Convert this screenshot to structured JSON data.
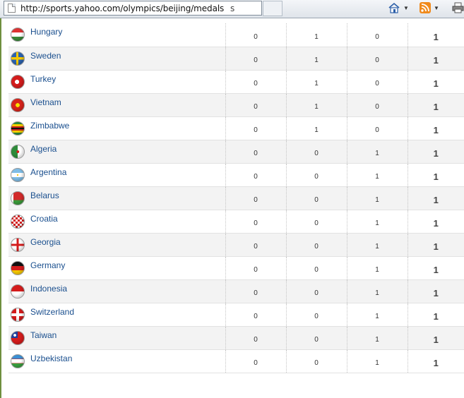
{
  "browser": {
    "url": "http://sports.yahoo.com/olympics/beijing/medals",
    "url_trailing": "s",
    "home_icon": "home-icon",
    "feeds_icon": "rss-feed-icon",
    "print_icon": "printer-icon"
  },
  "rows": [
    {
      "country": "Hungary",
      "gold": "0",
      "silver": "1",
      "bronze": "0",
      "total": "1",
      "flag": "linear-gradient(#d33 0 33%, #fff 33% 66%, #3a8a3a 66%)"
    },
    {
      "country": "Sweden",
      "gold": "0",
      "silver": "1",
      "bronze": "0",
      "total": "1",
      "flag": "linear-gradient(90deg, transparent 38%, #f6c900 38% 55%, transparent 55%), linear-gradient(transparent 40%, #f6c900 40% 58%, transparent 58%), #2a62b0"
    },
    {
      "country": "Turkey",
      "gold": "0",
      "silver": "1",
      "bronze": "0",
      "total": "1",
      "flag": "radial-gradient(circle at 45% 50%, #fff 0 22%, transparent 23%), #d41c1c"
    },
    {
      "country": "Vietnam",
      "gold": "0",
      "silver": "1",
      "bronze": "0",
      "total": "1",
      "flag": "radial-gradient(circle at 50% 50%, #f8e000 0 22%, transparent 23%), #d8231a"
    },
    {
      "country": "Zimbabwe",
      "gold": "0",
      "silver": "1",
      "bronze": "0",
      "total": "1",
      "flag": "linear-gradient(#2c8a3a 0 18%, #f6d000 18% 32%, #c8211c 32% 45%, #111 45% 55%, #c8211c 55% 68%, #f6d000 68% 82%, #2c8a3a 82%)"
    },
    {
      "country": "Algeria",
      "gold": "0",
      "silver": "0",
      "bronze": "1",
      "total": "1",
      "flag": "radial-gradient(circle at 52% 50%, #d41c1c 0 14%, transparent 15%), linear-gradient(90deg, #2e8b3a 50%, #fff 50%)"
    },
    {
      "country": "Argentina",
      "gold": "0",
      "silver": "0",
      "bronze": "1",
      "total": "1",
      "flag": "radial-gradient(circle at 50% 50%, #f0c400 0 8%, transparent 9%), linear-gradient(#7fbde6 0 33%, #fff 33% 66%, #7fbde6 66%)"
    },
    {
      "country": "Belarus",
      "gold": "0",
      "silver": "0",
      "bronze": "1",
      "total": "1",
      "flag": "linear-gradient(90deg, #fff 0 18%, transparent 18%), linear-gradient(#d22a2a 0 64%, #3a9a3a 64%)"
    },
    {
      "country": "Croatia",
      "gold": "0",
      "silver": "0",
      "bronze": "1",
      "total": "1",
      "flag": "repeating-conic-gradient(#d41c1c 0 25%, #fff 0 50%) 0 0 / 6px 6px, #fff"
    },
    {
      "country": "Georgia",
      "gold": "0",
      "silver": "0",
      "bronze": "1",
      "total": "1",
      "flag": "linear-gradient(90deg, transparent 42%, #d41c1c 42% 58%, transparent 58%), linear-gradient(transparent 42%, #d41c1c 42% 58%, transparent 58%), #fff"
    },
    {
      "country": "Germany",
      "gold": "0",
      "silver": "0",
      "bronze": "1",
      "total": "1",
      "flag": "linear-gradient(#111 0 33%, #d41c1c 33% 66%, #f6c900 66%)"
    },
    {
      "country": "Indonesia",
      "gold": "0",
      "silver": "0",
      "bronze": "1",
      "total": "1",
      "flag": "linear-gradient(#d41c1c 0 50%, #fff 50%)"
    },
    {
      "country": "Switzerland",
      "gold": "0",
      "silver": "0",
      "bronze": "1",
      "total": "1",
      "flag": "linear-gradient(90deg, transparent 40%, #fff 40% 60%, transparent 60%), linear-gradient(transparent 40%, #fff 40% 60%, transparent 60%), #d41c1c"
    },
    {
      "country": "Taiwan",
      "gold": "0",
      "silver": "0",
      "bronze": "1",
      "total": "1",
      "flag": "radial-gradient(circle at 28% 28%, #fff 0 10%, transparent 11%), linear-gradient(90deg, #1c3f9e 0 50%, transparent 50%) 0 0 / 100% 50% no-repeat, #d41c1c"
    },
    {
      "country": "Uzbekistan",
      "gold": "0",
      "silver": "0",
      "bronze": "1",
      "total": "1",
      "flag": "linear-gradient(#3a8fd4 0 30%, #d41c1c 30% 34%, #fff 34% 64%, #d41c1c 64% 68%, #3aa040 68%)"
    }
  ]
}
